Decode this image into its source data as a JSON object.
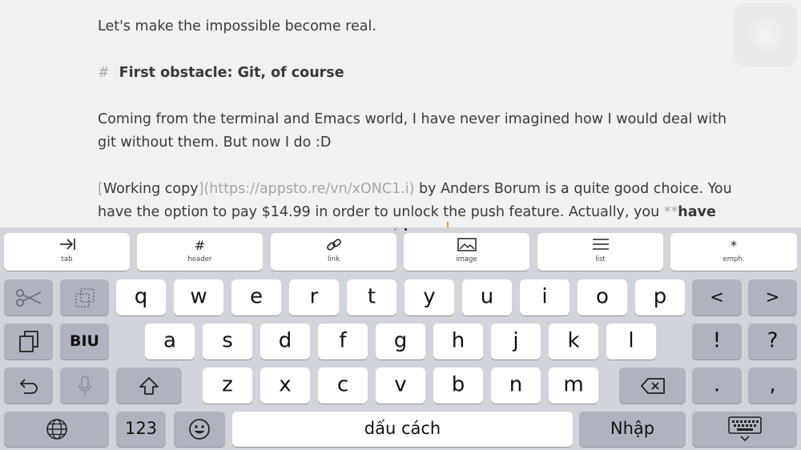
{
  "editor": {
    "line1": "Let's make the impossible become real.",
    "heading_hash": "#",
    "heading_text": "First obstacle: Git, of course",
    "para1_line1": "Coming from the terminal and Emacs world, I have never imagined how I would deal with",
    "para1_line2": "git without them. But now I do :D",
    "p2_open": "[",
    "p2_linktext": "Working copy",
    "p2_mid": "](https://appsto.re/vn/xONC1.i)",
    "p2_rest": " by Anders Borum is a quite good choice. You",
    "p3_text": "have the option to pay $14.99 in order to unlock the push feature. Actually, you ",
    "p3_marker": "**",
    "p3_bold": "have"
  },
  "toolbar": {
    "tab": "tab",
    "header": "header",
    "header_icon": "#",
    "link": "link",
    "image": "image",
    "list": "list",
    "emph": "emph.",
    "emph_icon": "*"
  },
  "keyboard": {
    "row1": [
      "q",
      "w",
      "e",
      "r",
      "t",
      "y",
      "u",
      "i",
      "o",
      "p"
    ],
    "row2": [
      "a",
      "s",
      "d",
      "f",
      "g",
      "h",
      "j",
      "k",
      "l"
    ],
    "row3": [
      "z",
      "x",
      "c",
      "v",
      "b",
      "n",
      "m"
    ],
    "left_arrow": "<",
    "right_arrow": ">",
    "exclaim": "!",
    "question": "?",
    "period": ".",
    "comma": ",",
    "biu": "BIU",
    "numbers": "123",
    "space": "dấu cách",
    "return": "Nhập"
  }
}
